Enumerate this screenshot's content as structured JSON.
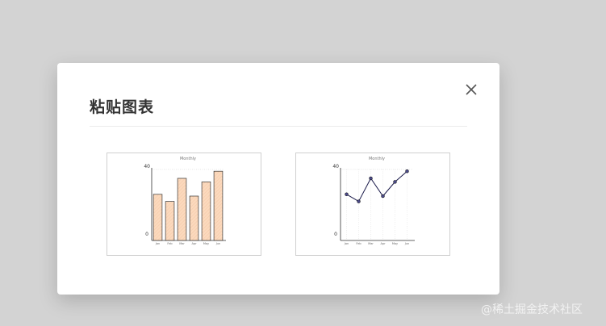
{
  "dialog": {
    "title": "粘贴图表",
    "close_icon": "close-icon",
    "colors": {
      "overlay": "#d3d3d3",
      "dialog_bg": "#ffffff",
      "bar_fill": "#fbd9bd",
      "bar_stroke": "#333333",
      "line_stroke": "#1a1a4a",
      "point_fill": "#4b4a8a"
    }
  },
  "charts": [
    {
      "name": "bar-chart-option",
      "chart_data": {
        "type": "bar",
        "title": "Monthly",
        "categories": [
          "Jan",
          "Feb",
          "Mar",
          "Apr",
          "May",
          "Jun"
        ],
        "values": [
          26,
          22,
          35,
          25,
          33,
          39
        ],
        "ylim": [
          0,
          40
        ],
        "y_ticks": [
          "0",
          "40"
        ]
      }
    },
    {
      "name": "line-chart-option",
      "chart_data": {
        "type": "line",
        "title": "Monthly",
        "categories": [
          "Jan",
          "Feb",
          "Mar",
          "Apr",
          "May",
          "Jun"
        ],
        "values": [
          26,
          22,
          35,
          25,
          33,
          39
        ],
        "ylim": [
          0,
          40
        ],
        "y_ticks": [
          "0",
          "40"
        ]
      }
    }
  ],
  "watermark": "@稀土掘金技术社区"
}
